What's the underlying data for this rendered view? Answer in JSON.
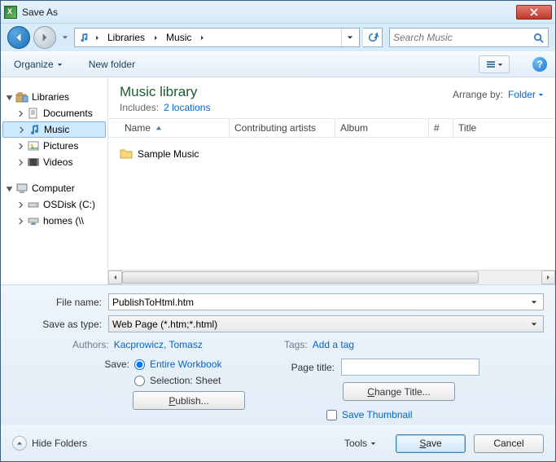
{
  "title": "Save As",
  "breadcrumb": {
    "seg1": "Libraries",
    "seg2": "Music"
  },
  "search": {
    "placeholder": "Search Music"
  },
  "toolbar": {
    "organize": "Organize",
    "newfolder": "New folder"
  },
  "tree": {
    "libraries": "Libraries",
    "documents": "Documents",
    "music": "Music",
    "pictures": "Pictures",
    "videos": "Videos",
    "computer": "Computer",
    "osdisk": "OSDisk (C:)",
    "homes": "homes (\\\\"
  },
  "libheader": {
    "title": "Music library",
    "includes_label": "Includes:",
    "includes_link": "2 locations",
    "arrange_label": "Arrange by:",
    "arrange_value": "Folder"
  },
  "columns": {
    "name": "Name",
    "contrib": "Contributing artists",
    "album": "Album",
    "num": "#",
    "title": "Title"
  },
  "files": {
    "item0": "Sample Music"
  },
  "form": {
    "filename_label": "File name:",
    "filename_value": "PublishToHtml.htm",
    "saveastype_label": "Save as type:",
    "saveastype_value": "Web Page (*.htm;*.html)",
    "authors_label": "Authors:",
    "authors_value": "Kacprowicz, Tomasz",
    "tags_label": "Tags:",
    "tags_value": "Add a tag",
    "save_label": "Save:",
    "opt_workbook": "Entire Workbook",
    "opt_selection": "Selection: Sheet",
    "publish": "Publish...",
    "pagetitle_label": "Page title:",
    "changetitle": "Change Title...",
    "savethumb": "Save Thumbnail"
  },
  "footer": {
    "hide": "Hide Folders",
    "tools": "Tools",
    "save": "Save",
    "cancel": "Cancel"
  }
}
